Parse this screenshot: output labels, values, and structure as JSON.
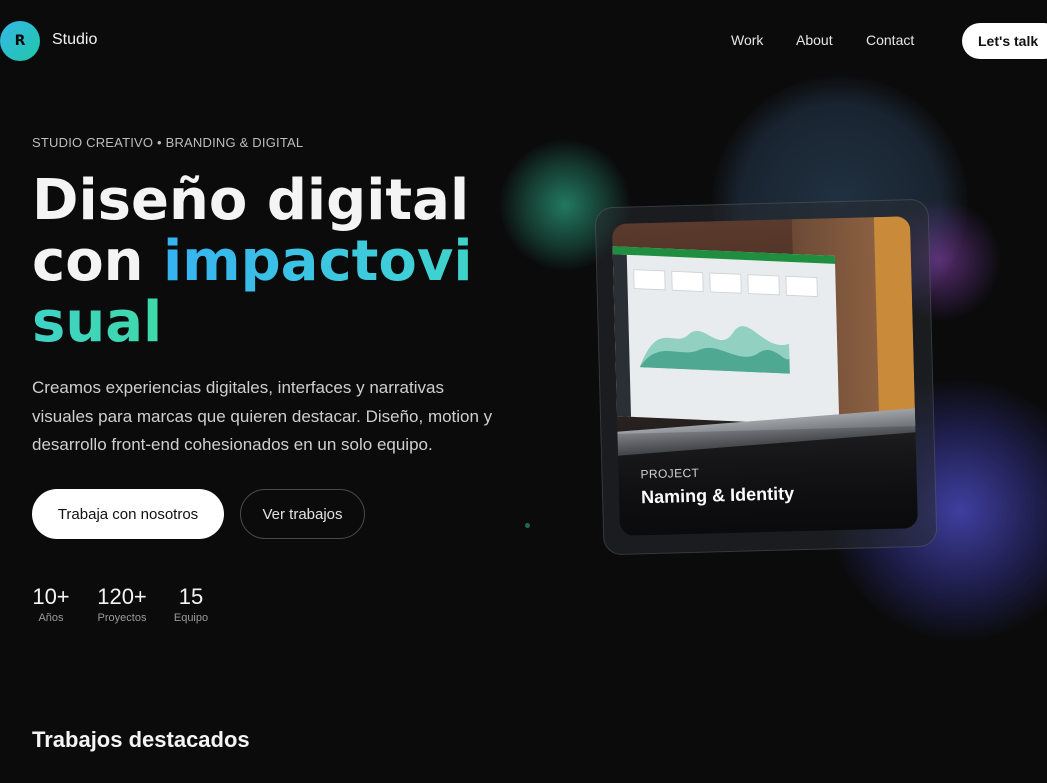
{
  "header": {
    "logo_letter": "R",
    "brand": "Studio",
    "nav": {
      "work": "Work",
      "about": "About",
      "contact": "Contact"
    },
    "cta": "Let's talk"
  },
  "hero": {
    "eyebrow": "STUDIO CREATIVO • BRANDING & DIGITAL",
    "headline_plain": "Diseño digital con ",
    "headline_highlight": "impactovisual",
    "lead": "Creamos experiencias digitales, interfaces y narrativas visuales para marcas que quieren destacar. Diseño, motion y desarrollo front-end cohesionados en un solo equipo.",
    "primary_button": "Trabaja con nosotros",
    "secondary_button": "Ver trabajos",
    "stats": [
      {
        "value": "10+",
        "label": "Años"
      },
      {
        "value": "120+",
        "label": "Proyectos"
      },
      {
        "value": "15",
        "label": "Equipo"
      }
    ]
  },
  "card": {
    "eyebrow": "PROJECT",
    "title": "Naming & Identity"
  },
  "featured": {
    "title": "Trabajos destacados"
  },
  "colors": {
    "background": "#0b0b0c",
    "gradient_start": "#36b3f2",
    "gradient_end": "#3fd9a8"
  }
}
